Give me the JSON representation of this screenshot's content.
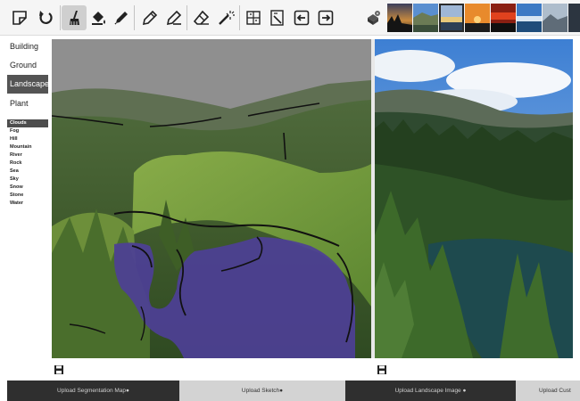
{
  "toolbar": {
    "tools": [
      {
        "name": "new-canvas-icon"
      },
      {
        "name": "redo-icon"
      },
      {
        "name": "brush-icon",
        "active": true
      },
      {
        "name": "fill-bucket-icon"
      },
      {
        "name": "dropper-icon"
      },
      {
        "name": "pencil-icon"
      },
      {
        "name": "pencil-eraser-icon"
      },
      {
        "name": "eraser-icon"
      },
      {
        "name": "magic-wand-icon"
      },
      {
        "name": "grid-icon"
      },
      {
        "name": "edit-layer-icon"
      },
      {
        "name": "arrow-left-icon"
      },
      {
        "name": "arrow-right-icon"
      },
      {
        "name": "dice-icon"
      }
    ],
    "thumbnails": [
      "sunset-pine",
      "mountain-sky",
      "lake-dawn",
      "orange-sunset",
      "red-sunset",
      "blue-lake",
      "cloudy-mountain",
      "dark-edge"
    ]
  },
  "categories": {
    "items": [
      "Building",
      "Ground",
      "Landscape",
      "Plant"
    ],
    "selected": "Landscape"
  },
  "labels": {
    "items": [
      "Clouds",
      "Fog",
      "Hill",
      "Mountain",
      "River",
      "Rock",
      "Sea",
      "Sky",
      "Snow",
      "Stone",
      "Water"
    ],
    "selected": "Clouds"
  },
  "upload": {
    "buttons": [
      {
        "label": "Upload Segmentation Map●",
        "style": "dark"
      },
      {
        "label": "Upload Sketch●",
        "style": "light"
      },
      {
        "label": "Upload Landscape Image ●",
        "style": "dark"
      },
      {
        "label": "Upload Cust",
        "style": "light"
      }
    ]
  },
  "colors": {
    "water_segment": "#4d3f96",
    "selected_bg": "#545454",
    "toolbar_bg": "#f5f5f5"
  }
}
